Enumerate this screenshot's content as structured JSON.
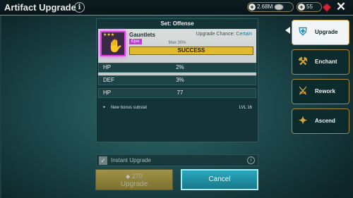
{
  "header": {
    "title": "Artifact Upgrade",
    "info_icon": "i",
    "silver": "2.68M",
    "gems": "55",
    "close_icon": "✕"
  },
  "panel": {
    "set_title": "Set: Offense",
    "item_name": "Gauntlets",
    "rarity": "Epic",
    "chance_label": "Upgrade Chance:",
    "chance_value": "Certain",
    "max_label": "Max 30%",
    "result": "SUCCESS",
    "stats": [
      {
        "name": "HP",
        "value": "2%"
      },
      {
        "name": "DEF",
        "value": "3%"
      },
      {
        "name": "HP",
        "value": "77"
      }
    ],
    "bonus_text": "New bonus substat",
    "bonus_level": "LVL 16"
  },
  "instant": {
    "label": "Instant Upgrade",
    "checked": true,
    "info_icon": "i"
  },
  "buttons": {
    "upgrade_cost": "270",
    "upgrade_label": "Upgrade",
    "cancel_label": "Cancel"
  },
  "side_tabs": [
    {
      "label": "Upgrade",
      "icon": "armor-icon",
      "active": true
    },
    {
      "label": "Enchant",
      "icon": "anvil-icon",
      "active": false
    },
    {
      "label": "Rework",
      "icon": "hammer-icon",
      "active": false
    },
    {
      "label": "Ascend",
      "icon": "ascend-icon",
      "active": false
    }
  ],
  "colors": {
    "accent_gold": "#e1b92f",
    "epic_purple": "#e23be8",
    "cancel_teal": "#2aa8bd",
    "chance_blue": "#1d6e87"
  }
}
